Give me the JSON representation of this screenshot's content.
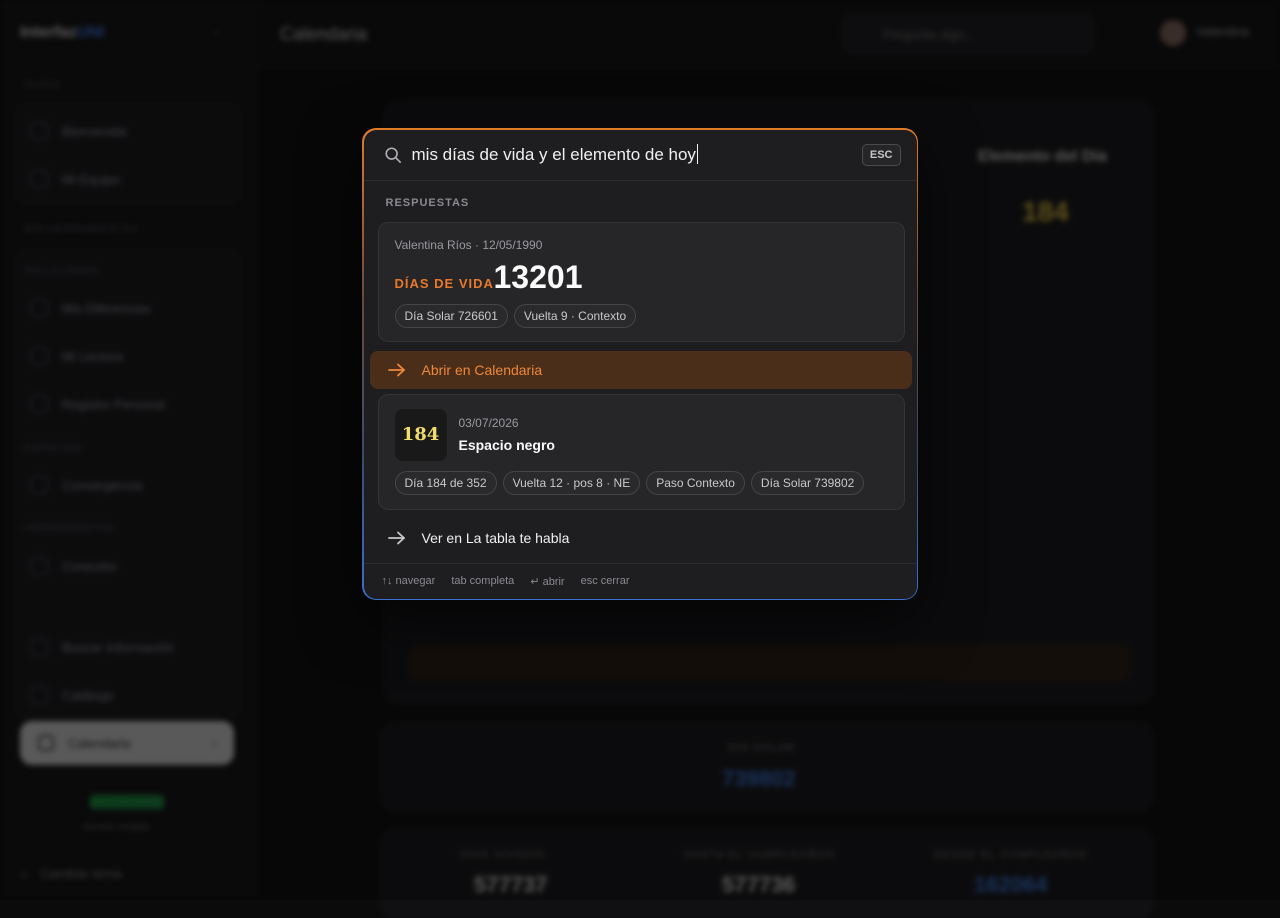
{
  "background": {
    "brand": {
      "name": "Interfaz",
      "accent": "UNI"
    },
    "sidebar": {
      "sections": [
        "INICIO",
        "MIS HERRAMIENTAS",
        "SOLUCIONES",
        "ESPACIOS",
        "HERRAMIENTAS"
      ],
      "items": [
        "Bienvenida",
        "Mi Equipo",
        "Mis Diferencias",
        "Mi Lectura",
        "Registro Personal",
        "Convergencia",
        "Conexión",
        "Buscar Información",
        "Catálogo"
      ],
      "active_item": "Calendaria",
      "status": "CONECTADO",
      "footer": "Versión estable",
      "theme_toggle": "Cambiar tema"
    },
    "topbar": {
      "title": "Calendaria",
      "search_placeholder": "Pregunta algo...",
      "user": "Valentina"
    },
    "element_panel": {
      "title": "Elemento del Día",
      "number": "184"
    },
    "stats": {
      "dia_solar_label": "DÍA SOLAR",
      "dia_solar_value": "739802",
      "items": [
        {
          "label": "DÍAS VIVIDOS",
          "value": "577737"
        },
        {
          "label": "HASTA EL CUMPLEAÑOS",
          "value": "577736"
        },
        {
          "label": "DESDE EL CUMPLEAÑOS",
          "value": "162064"
        }
      ]
    }
  },
  "palette": {
    "query": "mis días de vida y el elemento de hoy",
    "esc_label": "ESC",
    "section_label": "RESPUESTAS",
    "card1": {
      "meta": "Valentina Ríos · 12/05/1990",
      "label": "DÍAS DE VIDA",
      "value": "13201",
      "chips": [
        "Día Solar 726601",
        "Vuelta 9 · Contexto"
      ]
    },
    "action1": "Abrir en Calendaria",
    "card2": {
      "tile_number": "184",
      "date": "03/07/2026",
      "name": "Espacio negro",
      "chips": [
        "Día 184 de 352",
        "Vuelta 12 · pos 8 · NE",
        "Paso Contexto",
        "Día Solar 739802"
      ]
    },
    "action2": "Ver en La tabla te habla",
    "footer": {
      "navigate": "↑↓ navegar",
      "tab": "tab completa",
      "open": "↵ abrir",
      "close": "esc cerrar"
    }
  },
  "colors": {
    "accent_orange": "#e8792c",
    "accent_blue": "#3c79e6",
    "tile_yellow": "#f3dd6a",
    "active_row_bg": "#4a2e1a"
  },
  "icons": [
    "search-icon",
    "arrow-right-icon"
  ]
}
